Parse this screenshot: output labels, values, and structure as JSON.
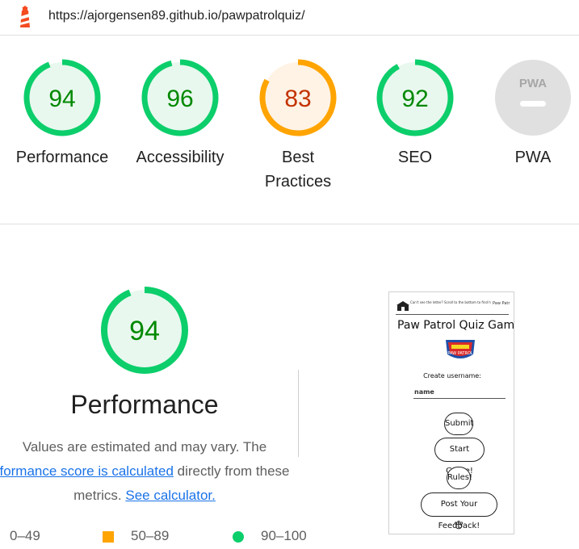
{
  "header": {
    "url": "https://ajorgensen89.github.io/pawpatrolquiz/"
  },
  "categories": [
    {
      "score": "94",
      "label": "Performance",
      "status": "pass"
    },
    {
      "score": "96",
      "label": "Accessibility",
      "status": "pass"
    },
    {
      "score": "83",
      "label": "Best Practices",
      "status": "average"
    },
    {
      "score": "92",
      "label": "SEO",
      "status": "pass"
    },
    {
      "score": "PWA",
      "label": "PWA",
      "status": "na"
    }
  ],
  "performance": {
    "score": "94",
    "title": "Performance",
    "desc_line1": "Values are estimated and may vary. The",
    "desc_link1": "formance score is calculated",
    "desc_line2_rest": " directly from these",
    "desc_line3": "metrics.",
    "desc_link2": "See calculator."
  },
  "legend": {
    "fail": "0–49",
    "average": "50–89",
    "pass": "90–100"
  },
  "screenshot": {
    "banner": "Can't see the letter? Scroll to the bottom to find help!",
    "corner": "Paw Patr",
    "heading": "Paw Patrol Quiz Gam",
    "logo_text": "PAW PATROL",
    "create_label": "Create username:",
    "name_placeholder": "name",
    "btn_submit": "Submit",
    "btn_start": "Start Game!",
    "btn_rules": "Rules!",
    "btn_feedback": "Post Your Feedback!"
  },
  "colors": {
    "pass": "#0cce6b",
    "pass_text": "#008800",
    "pass_bg": "#e8f8ee",
    "average": "#ffa400",
    "average_text": "#c33300",
    "average_bg": "#fff3e6",
    "na": "#e0e0e0",
    "link": "#1a73e8"
  }
}
